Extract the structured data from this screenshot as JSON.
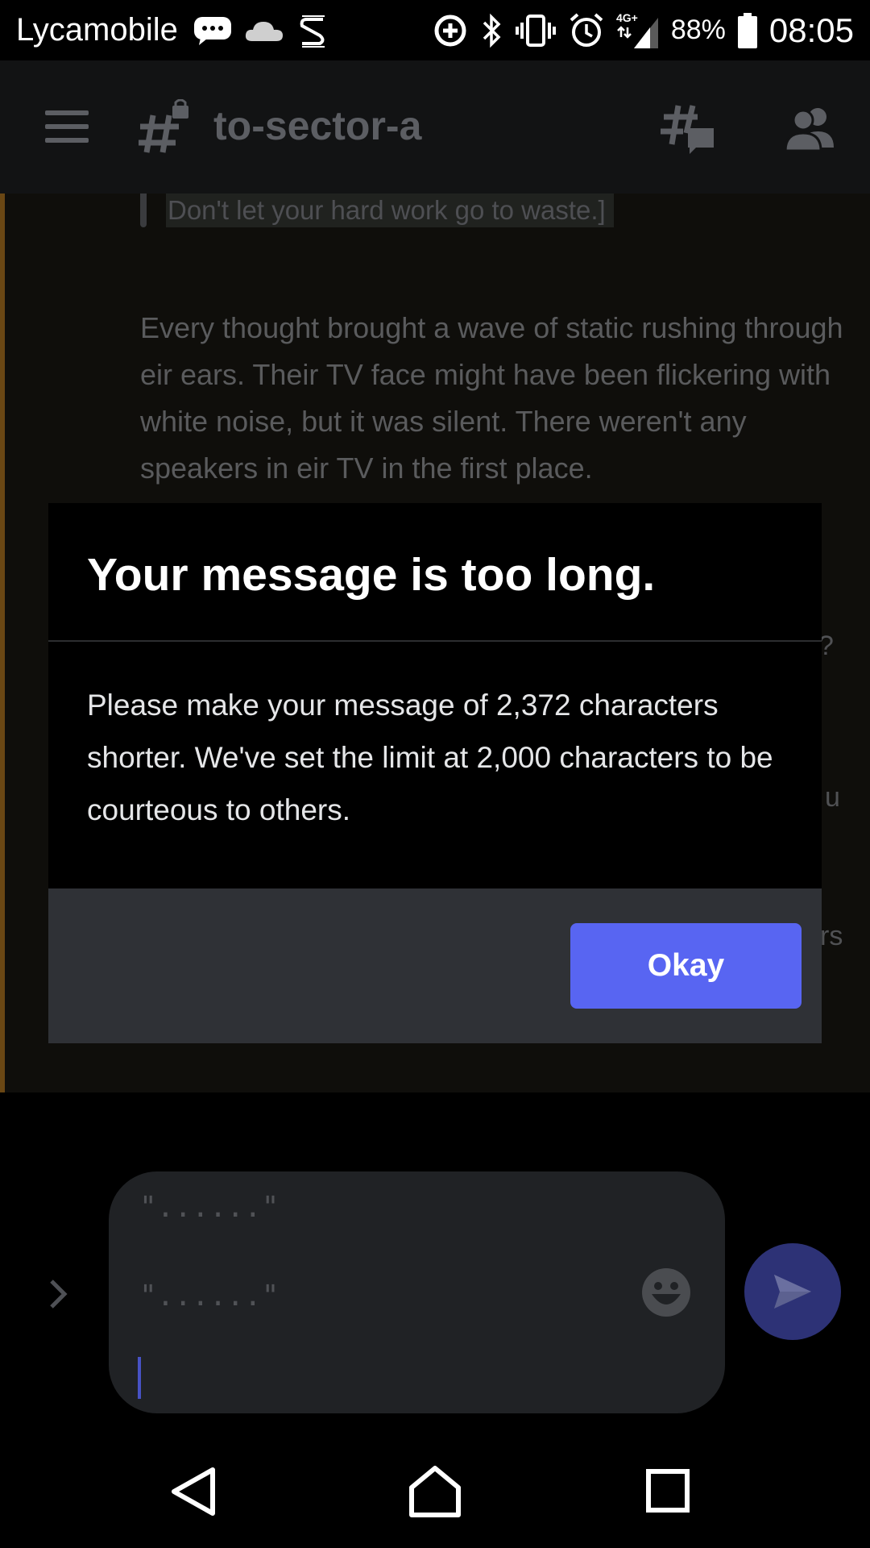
{
  "status_bar": {
    "carrier": "Lycamobile",
    "network": "4G+",
    "battery": "88%",
    "time": "08:05",
    "icons": [
      "message-icon",
      "cloud-icon",
      "s-icon",
      "data-saver-icon",
      "bluetooth-icon",
      "vibrate-icon",
      "alarm-icon",
      "signal-icon",
      "battery-icon"
    ]
  },
  "header": {
    "channel_name": "to-sector-a",
    "icons": [
      "menu-icon",
      "locked-channel-icon",
      "threads-icon",
      "members-icon"
    ]
  },
  "chat": {
    "quote_text": "Don't let your hard work go to waste.]",
    "paragraph": "Every thought brought a wave of static rushing through eir ears. Their TV face might have been flickering with white noise, but it was silent. There weren't any speakers in eir TV in the first place.",
    "peek_1": "?",
    "peek_2": "u",
    "peek_3": "rs",
    "divider_left_paren": "(",
    "divider_right_paren": ")",
    "divider_emoji": "tv-emoji"
  },
  "dialog": {
    "title": "Your message is too long.",
    "body": "Please make your message of 2,372 characters shorter. We've set the limit at 2,000 characters to be courteous to others.",
    "okay_label": "Okay"
  },
  "composer": {
    "line_1": "\"......\"",
    "line_2": "\"......\"",
    "icons": [
      "expand-chevron-icon",
      "emoji-icon",
      "send-icon"
    ]
  },
  "colors": {
    "accent": "#5865f2",
    "dialog_footer": "#2f3136",
    "header_bg": "#121314",
    "input_bg": "#202225"
  }
}
